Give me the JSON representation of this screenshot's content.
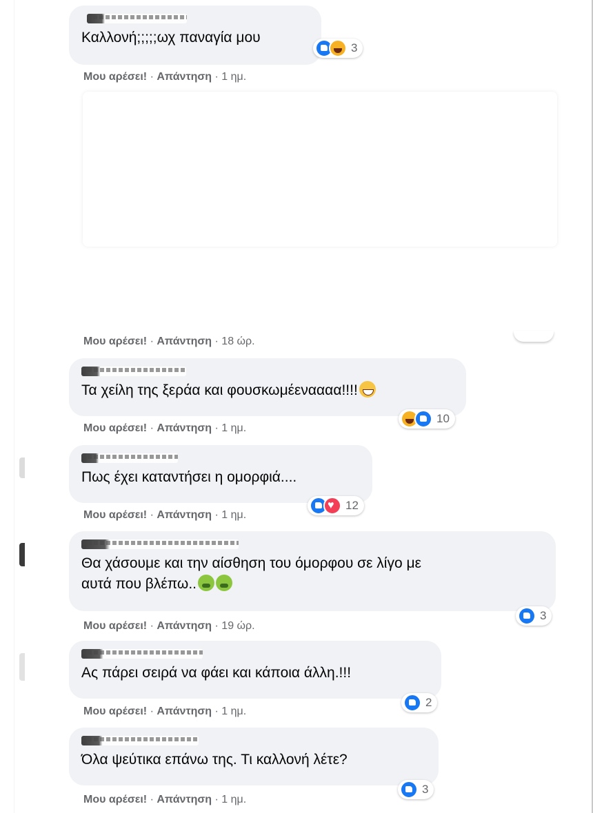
{
  "comments": [
    {
      "text": "Καλλονή;;;;;ωχ παναγία μου",
      "reactions": "3",
      "time": "1 ημ."
    },
    {
      "time": "18 ώρ."
    },
    {
      "text": "Τα χείλη της ξεράα και φουσκωμέεναααα!!!!",
      "reactions": "10",
      "time": "1 ημ."
    },
    {
      "text": "Πως έχει καταντήσει η ομορφιά....",
      "reactions": "12",
      "time": "1 ημ."
    },
    {
      "text": "Θα χάσουμε και την αίσθηση του όμορφου σε λίγο με\nαυτά που βλέπω..",
      "reactions": "3",
      "time": "19 ώρ."
    },
    {
      "text": "Ας πάρει σειρά να φάει και κάποια άλλη.!!!",
      "reactions": "2",
      "time": "1 ημ."
    },
    {
      "text": "Όλα ψεύτικα επάνω της. Τι καλλονή λέτε?",
      "reactions": "3",
      "time": "1 ημ."
    }
  ],
  "actions": {
    "like": "Μου αρέσει!",
    "separator": " · ",
    "reply": "Απάντηση",
    "dot": " · "
  },
  "icons": {
    "like": "thumbs-up-reaction-icon",
    "haha": "laughing-reaction-icon",
    "love": "heart-reaction-icon",
    "grin": "grinning-emoji",
    "sick": "nauseated-emoji"
  },
  "colors": {
    "bubble": "#f0f2f5",
    "like_blue": "#1877f2",
    "meta_gray": "#65676b",
    "text": "#050505"
  }
}
